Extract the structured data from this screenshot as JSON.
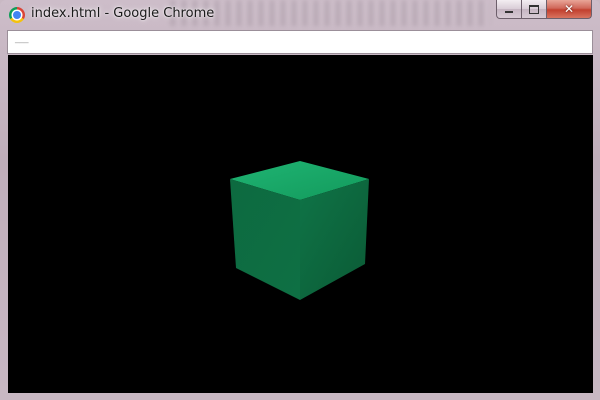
{
  "window": {
    "title": "index.html - Google Chrome",
    "app_icon": "chrome-icon"
  },
  "controls": {
    "minimize_icon": "minimize-icon",
    "maximize_icon": "maximize-icon",
    "close_icon": "close-icon",
    "close_glyph": "✕"
  },
  "addressbar": {
    "text": "___"
  },
  "viewport": {
    "background": "#000000"
  },
  "cube": {
    "top_color": "#1cae6e",
    "left_color": "#0f6b40",
    "right_color": "#0c5a35"
  }
}
